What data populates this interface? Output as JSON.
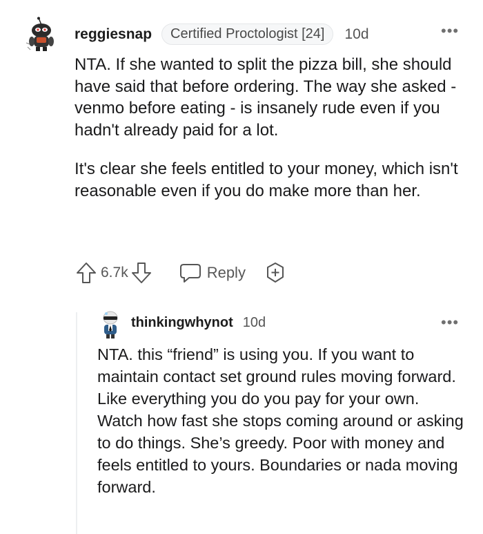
{
  "comments": [
    {
      "username": "reggiesnap",
      "flair": "Certified Proctologist [24]",
      "time": "10d",
      "paragraphs": [
        "NTA. If she wanted to split the pizza bill, she should have said that before ordering. The way she asked - venmo before eating - is insanely rude even if you hadn't already paid for a lot.",
        "It's clear she feels entitled to your money, which isn't reasonable even if you do make more than her."
      ],
      "votes": "6.7k",
      "reply_label": "Reply"
    },
    {
      "username": "thinkingwhynot",
      "time": "10d",
      "paragraphs": [
        "NTA. this “friend” is using you. If you want to maintain contact set ground rules moving forward. Like everything you do you pay for your own. Watch how fast she stops coming around or asking to do things. She’s greedy. Poor with money and feels entitled to yours. Boundaries or nada moving forward."
      ]
    }
  ],
  "icons": {
    "more": "more-options-icon",
    "upvote": "upvote-arrow-icon",
    "downvote": "downvote-arrow-icon",
    "reply": "speech-bubble-icon",
    "award": "award-plus-icon"
  },
  "colors": {
    "text": "#1a1a1b",
    "muted": "#575757",
    "flair_bg": "#f6f7f8",
    "thread_line": "#edeff1"
  }
}
